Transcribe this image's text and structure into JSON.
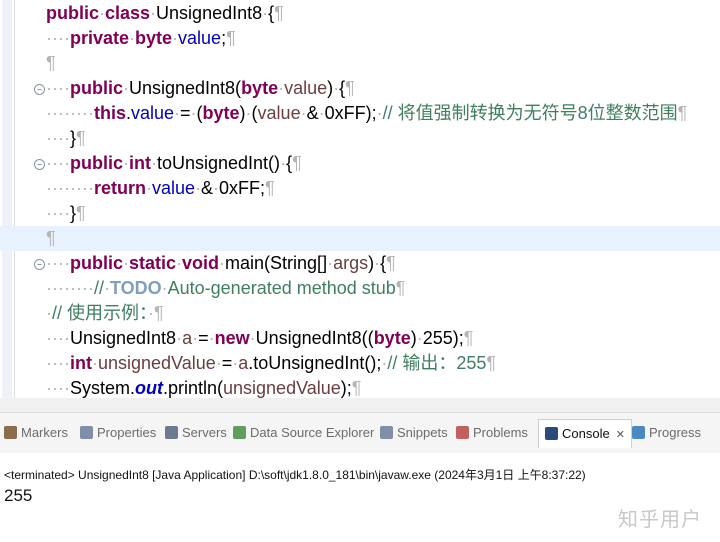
{
  "editor": {
    "lines": [
      {
        "tokens": [
          [
            "kw",
            "public"
          ],
          [
            "ws",
            "·"
          ],
          [
            "kw",
            "class"
          ],
          [
            "ws",
            "·"
          ],
          [
            "",
            "UnsignedInt8"
          ],
          [
            "ws",
            "·"
          ],
          [
            "",
            "{"
          ],
          [
            "ws",
            "¶"
          ]
        ]
      },
      {
        "tokens": [
          [
            "ws",
            "····"
          ],
          [
            "kw",
            "private"
          ],
          [
            "ws",
            "·"
          ],
          [
            "kw",
            "byte"
          ],
          [
            "ws",
            "·"
          ],
          [
            "fld",
            "value"
          ],
          [
            "",
            ";"
          ],
          [
            "ws",
            "¶"
          ]
        ]
      },
      {
        "tokens": [
          [
            "ws",
            "¶"
          ]
        ]
      },
      {
        "tokens": [
          [
            "ws",
            "····"
          ],
          [
            "kw",
            "public"
          ],
          [
            "ws",
            "·"
          ],
          [
            "",
            "UnsignedInt8("
          ],
          [
            "kw",
            "byte"
          ],
          [
            "ws",
            "·"
          ],
          [
            "var",
            "value"
          ],
          [
            "",
            ")"
          ],
          [
            "ws",
            "·"
          ],
          [
            "",
            "{"
          ],
          [
            "ws",
            "¶"
          ]
        ]
      },
      {
        "tokens": [
          [
            "ws",
            "········"
          ],
          [
            "kw",
            "this"
          ],
          [
            "",
            "."
          ],
          [
            "fld",
            "value"
          ],
          [
            "ws",
            "·"
          ],
          [
            "",
            "="
          ],
          [
            "ws",
            "·"
          ],
          [
            "",
            "("
          ],
          [
            "kw",
            "byte"
          ],
          [
            "",
            ")"
          ],
          [
            "ws",
            "·"
          ],
          [
            "",
            "("
          ],
          [
            "var",
            "value"
          ],
          [
            "ws",
            "·"
          ],
          [
            "",
            "&"
          ],
          [
            "ws",
            "·"
          ],
          [
            "",
            "0xFF);"
          ],
          [
            "ws",
            "·"
          ],
          [
            "cm",
            "// 将值强制转换为无符号8位整数范围"
          ],
          [
            "ws",
            "¶"
          ]
        ]
      },
      {
        "tokens": [
          [
            "ws",
            "····"
          ],
          [
            "",
            "}"
          ],
          [
            "ws",
            "¶"
          ]
        ]
      },
      {
        "tokens": [
          [
            "ws",
            "····"
          ],
          [
            "kw",
            "public"
          ],
          [
            "ws",
            "·"
          ],
          [
            "kw",
            "int"
          ],
          [
            "ws",
            "·"
          ],
          [
            "",
            "toUnsignedInt()"
          ],
          [
            "ws",
            "·"
          ],
          [
            "",
            "{"
          ],
          [
            "ws",
            "¶"
          ]
        ]
      },
      {
        "tokens": [
          [
            "ws",
            "········"
          ],
          [
            "kw",
            "return"
          ],
          [
            "ws",
            "·"
          ],
          [
            "fld",
            "value"
          ],
          [
            "ws",
            "·"
          ],
          [
            "",
            "&"
          ],
          [
            "ws",
            "·"
          ],
          [
            "",
            "0xFF;"
          ],
          [
            "ws",
            "¶"
          ]
        ]
      },
      {
        "tokens": [
          [
            "ws",
            "····"
          ],
          [
            "",
            "}"
          ],
          [
            "ws",
            "¶"
          ]
        ]
      },
      {
        "tokens": [
          [
            "ws",
            "¶"
          ]
        ]
      },
      {
        "tokens": [
          [
            "ws",
            "····"
          ],
          [
            "kw",
            "public"
          ],
          [
            "ws",
            "·"
          ],
          [
            "kw",
            "static"
          ],
          [
            "ws",
            "·"
          ],
          [
            "kw",
            "void"
          ],
          [
            "ws",
            "·"
          ],
          [
            "",
            "main(String[]"
          ],
          [
            "ws",
            "·"
          ],
          [
            "var",
            "args"
          ],
          [
            "",
            ")"
          ],
          [
            "ws",
            "·"
          ],
          [
            "",
            "{"
          ],
          [
            "ws",
            "¶"
          ]
        ]
      },
      {
        "tokens": [
          [
            "ws",
            "········"
          ],
          [
            "cm",
            "//"
          ],
          [
            "ws",
            "·"
          ],
          [
            "todo",
            "TODO"
          ],
          [
            "ws",
            "·"
          ],
          [
            "cm",
            "Auto-generated method stub"
          ],
          [
            "ws",
            "¶"
          ]
        ]
      },
      {
        "tokens": [
          [
            "ws",
            "·"
          ],
          [
            "cm",
            "// 使用示例："
          ],
          [
            "ws",
            "·¶"
          ]
        ]
      },
      {
        "tokens": [
          [
            "ws",
            "····"
          ],
          [
            "",
            "UnsignedInt8"
          ],
          [
            "ws",
            "·"
          ],
          [
            "var",
            "a"
          ],
          [
            "ws",
            "·"
          ],
          [
            "",
            "="
          ],
          [
            "ws",
            "·"
          ],
          [
            "kw",
            "new"
          ],
          [
            "ws",
            "·"
          ],
          [
            "",
            "UnsignedInt8(("
          ],
          [
            "kw",
            "byte"
          ],
          [
            "",
            ")"
          ],
          [
            "ws",
            "·"
          ],
          [
            "",
            "255);"
          ],
          [
            "ws",
            "¶"
          ]
        ]
      },
      {
        "tokens": [
          [
            "ws",
            "····"
          ],
          [
            "kw",
            "int"
          ],
          [
            "ws",
            "·"
          ],
          [
            "var",
            "unsignedValue"
          ],
          [
            "ws",
            "·"
          ],
          [
            "",
            "="
          ],
          [
            "ws",
            "·"
          ],
          [
            "var",
            "a"
          ],
          [
            "",
            ".toUnsignedInt();"
          ],
          [
            "ws",
            "·"
          ],
          [
            "cm",
            "// 输出：255"
          ],
          [
            "ws",
            "¶"
          ]
        ]
      },
      {
        "tokens": [
          [
            "ws",
            "····"
          ],
          [
            "",
            "System."
          ],
          [
            "it",
            "out"
          ],
          [
            "",
            ".println("
          ],
          [
            "var",
            "unsignedValue"
          ],
          [
            "",
            ");"
          ],
          [
            "ws",
            "¶"
          ]
        ]
      }
    ],
    "highlighted_line": 9,
    "fold_lines": [
      3,
      6,
      10
    ]
  },
  "tabs": [
    {
      "label": "Markers",
      "icon": "markers-icon",
      "color": "#8a6d4a"
    },
    {
      "label": "Properties",
      "icon": "properties-icon",
      "color": "#7f8fa8"
    },
    {
      "label": "Servers",
      "icon": "servers-icon",
      "color": "#6b7a8f"
    },
    {
      "label": "Data Source Explorer",
      "icon": "data-source-icon",
      "color": "#5f9e5f"
    },
    {
      "label": "Snippets",
      "icon": "snippets-icon",
      "color": "#7f8fa8"
    },
    {
      "label": "Problems",
      "icon": "problems-icon",
      "color": "#c06060"
    },
    {
      "label": "Console",
      "icon": "console-icon",
      "color": "#2a4a7a",
      "active": true
    },
    {
      "label": "Progress",
      "icon": "progress-icon",
      "color": "#4a8ac0"
    }
  ],
  "console": {
    "status": "<terminated> UnsignedInt8 [Java Application] D:\\soft\\jdk1.8.0_181\\bin\\javaw.exe  (2024年3月1日 上午8:37:22)",
    "output": "255"
  },
  "watermark": "知乎用户"
}
